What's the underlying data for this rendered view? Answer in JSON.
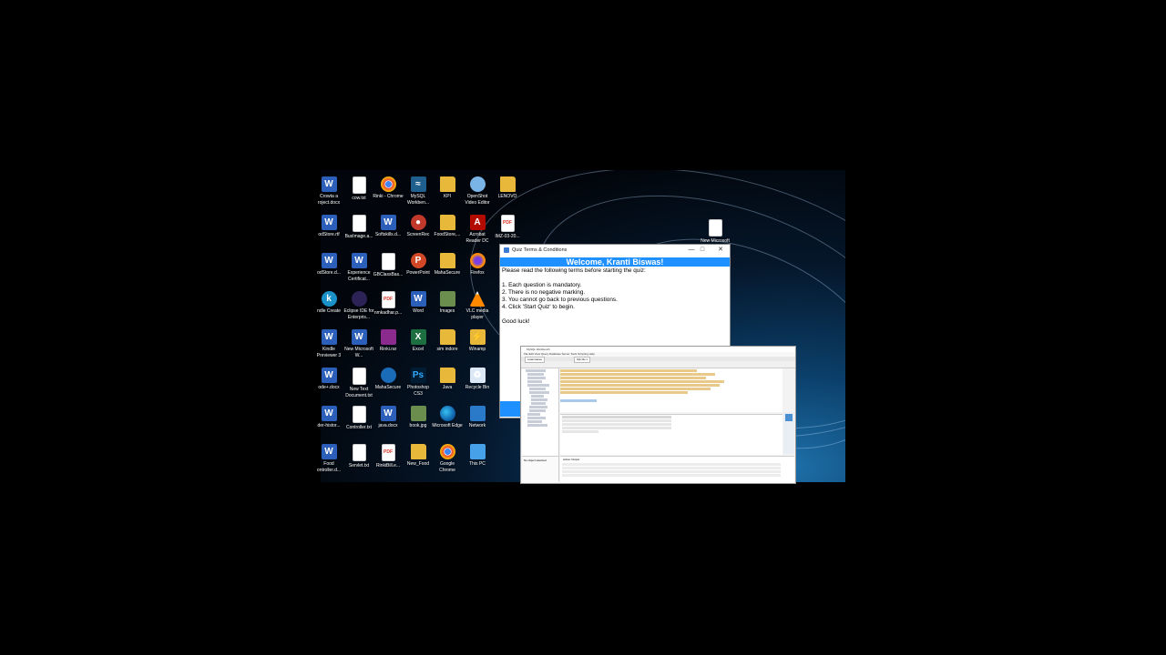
{
  "desktop": {
    "icons": [
      {
        "name": "icon-create-a-project-docx",
        "type": "word",
        "glyph": "W",
        "label": "Crowta a roject.docx",
        "col": 0,
        "row": 0
      },
      {
        "name": "icon-cow-txt",
        "type": "doc",
        "glyph": "",
        "label": "cow.txt",
        "col": 1,
        "row": 0
      },
      {
        "name": "icon-rinki-chrome",
        "type": "chrome",
        "glyph": "",
        "label": "Rinki - Chrome",
        "col": 2,
        "row": 0
      },
      {
        "name": "icon-mysql-workbench",
        "type": "mysql",
        "glyph": "≈",
        "label": "MySQL Workben...",
        "col": 3,
        "row": 0
      },
      {
        "name": "icon-kpi-folder",
        "type": "folder",
        "glyph": "",
        "label": "KPI",
        "col": 4,
        "row": 0
      },
      {
        "name": "icon-openshot-video-editor",
        "type": "openshot",
        "glyph": "",
        "label": "OpenShot Video Editor",
        "col": 5,
        "row": 0
      },
      {
        "name": "icon-lenovo-folder",
        "type": "folder",
        "glyph": "",
        "label": "LENOVO",
        "col": 6,
        "row": 0
      },
      {
        "name": "icon-foodstore-rtf",
        "type": "word",
        "glyph": "W",
        "label": "odStore.rtf",
        "col": 0,
        "row": 1
      },
      {
        "name": "icon-busimage",
        "type": "doc",
        "glyph": "",
        "label": "BusImage.a...",
        "col": 1,
        "row": 1
      },
      {
        "name": "icon-softskills",
        "type": "word",
        "glyph": "W",
        "label": "Softskills.d...",
        "col": 2,
        "row": 1
      },
      {
        "name": "icon-screenrec",
        "type": "screenrec",
        "glyph": "●",
        "label": "ScreenRec",
        "col": 3,
        "row": 1
      },
      {
        "name": "icon-foodstore-folder",
        "type": "folder",
        "glyph": "",
        "label": "FoodStore,...",
        "col": 4,
        "row": 1
      },
      {
        "name": "icon-acrobat-reader",
        "type": "acro",
        "glyph": "A",
        "label": "Acrobat Reader DC",
        "col": 5,
        "row": 1
      },
      {
        "name": "icon-pdf-file",
        "type": "pdf",
        "glyph": "PDF",
        "label": "IMZ-03-20...",
        "col": 6,
        "row": 1
      },
      {
        "name": "icon-foodstore-docx",
        "type": "word",
        "glyph": "W",
        "label": "odStore.d...",
        "col": 0,
        "row": 2
      },
      {
        "name": "icon-experience-certificate",
        "type": "word",
        "glyph": "W",
        "label": "Experience Certificat...",
        "col": 1,
        "row": 2
      },
      {
        "name": "icon-gbclassbas",
        "type": "doc",
        "glyph": "",
        "label": "GBClassBas...",
        "col": 2,
        "row": 2
      },
      {
        "name": "icon-powerpoint",
        "type": "ppt",
        "glyph": "P",
        "label": "PowerPoint",
        "col": 3,
        "row": 2
      },
      {
        "name": "icon-mahasecure-folder",
        "type": "folder",
        "glyph": "",
        "label": "MahaSecure",
        "col": 4,
        "row": 2
      },
      {
        "name": "icon-firefox",
        "type": "firefox",
        "glyph": "",
        "label": "Firefox",
        "col": 5,
        "row": 2
      },
      {
        "name": "icon-kindle-create",
        "type": "kindle",
        "glyph": "k",
        "label": "ndle Create",
        "col": 0,
        "row": 3
      },
      {
        "name": "icon-eclipse-ide",
        "type": "eclipse",
        "glyph": "",
        "label": "Eclipse IDE for Enterpris...",
        "col": 1,
        "row": 3
      },
      {
        "name": "icon-nmkadhar-pdf",
        "type": "pdf",
        "glyph": "PDF",
        "label": "nmkadhar.p...",
        "col": 2,
        "row": 3
      },
      {
        "name": "icon-word",
        "type": "word",
        "glyph": "W",
        "label": "Word",
        "col": 3,
        "row": 3
      },
      {
        "name": "icon-images-folder",
        "type": "img",
        "glyph": "",
        "label": "Images",
        "col": 4,
        "row": 3
      },
      {
        "name": "icon-vlc-media-player",
        "type": "vlc",
        "glyph": "",
        "label": "VLC media player",
        "col": 5,
        "row": 3
      },
      {
        "name": "icon-kindle-previewer",
        "type": "word",
        "glyph": "W",
        "label": "Kindle Previewer 3",
        "col": 0,
        "row": 4
      },
      {
        "name": "icon-new-microsoft-word",
        "type": "word",
        "glyph": "W",
        "label": "New Microsoft W...",
        "col": 1,
        "row": 4
      },
      {
        "name": "icon-rinki-rar",
        "type": "rar",
        "glyph": "",
        "label": "Rinki.rar",
        "col": 2,
        "row": 4
      },
      {
        "name": "icon-excel",
        "type": "excel",
        "glyph": "X",
        "label": "Excel",
        "col": 3,
        "row": 4
      },
      {
        "name": "icon-sim-indore-folder",
        "type": "folder",
        "glyph": "",
        "label": "sim indore",
        "col": 4,
        "row": 4
      },
      {
        "name": "icon-winamp",
        "type": "winamp",
        "glyph": "⚡",
        "label": "Winamp",
        "col": 5,
        "row": 4
      },
      {
        "name": "icon-code-docx",
        "type": "word",
        "glyph": "W",
        "label": "ode+.docx",
        "col": 0,
        "row": 5
      },
      {
        "name": "icon-new-text-document",
        "type": "doc",
        "glyph": "",
        "label": "New Text Document.txt",
        "col": 1,
        "row": 5
      },
      {
        "name": "icon-mahasecure",
        "type": "shield",
        "glyph": "",
        "label": "MahaSecure",
        "col": 2,
        "row": 5
      },
      {
        "name": "icon-photoshop-cs3",
        "type": "ps",
        "glyph": "Ps",
        "label": "Photoshop CS3",
        "col": 3,
        "row": 5
      },
      {
        "name": "icon-java-folder",
        "type": "folder",
        "glyph": "",
        "label": "Java",
        "col": 4,
        "row": 5
      },
      {
        "name": "icon-recycle-bin",
        "type": "recycle",
        "glyph": "♻",
        "label": "Recycle Bin",
        "col": 5,
        "row": 5
      },
      {
        "name": "icon-order-history",
        "type": "word",
        "glyph": "W",
        "label": "der-histor...",
        "col": 0,
        "row": 6
      },
      {
        "name": "icon-controller-txt",
        "type": "doc",
        "glyph": "",
        "label": "Controller.txt",
        "col": 1,
        "row": 6
      },
      {
        "name": "icon-java-docx",
        "type": "word",
        "glyph": "W",
        "label": "java.docx",
        "col": 2,
        "row": 6
      },
      {
        "name": "icon-book-jpg",
        "type": "img",
        "glyph": "",
        "label": "book.jpg",
        "col": 3,
        "row": 6
      },
      {
        "name": "icon-microsoft-edge",
        "type": "edge",
        "glyph": "",
        "label": "Microsoft Edge",
        "col": 4,
        "row": 6
      },
      {
        "name": "icon-network",
        "type": "network",
        "glyph": "",
        "label": "Network",
        "col": 5,
        "row": 6
      },
      {
        "name": "icon-food-controller",
        "type": "word",
        "glyph": "W",
        "label": "Food ontroller.d...",
        "col": 0,
        "row": 7
      },
      {
        "name": "icon-servlet-txt",
        "type": "doc",
        "glyph": "",
        "label": "Servlet.txt",
        "col": 1,
        "row": 7
      },
      {
        "name": "icon-rinkibill-pdf",
        "type": "pdf",
        "glyph": "PDF",
        "label": "RinkiBill.e...",
        "col": 2,
        "row": 7
      },
      {
        "name": "icon-new-food-folder",
        "type": "folder",
        "glyph": "",
        "label": "New_Food",
        "col": 3,
        "row": 7
      },
      {
        "name": "icon-google-chrome",
        "type": "chrome",
        "glyph": "",
        "label": "Google Chrome",
        "col": 4,
        "row": 7
      },
      {
        "name": "icon-this-pc",
        "type": "thispc",
        "glyph": "",
        "label": "This PC",
        "col": 5,
        "row": 7
      }
    ],
    "right_icon": {
      "name": "icon-new-microsoft-powerpoint",
      "type": "pdf",
      "glyph": "",
      "label": "New Microsoft P..."
    }
  },
  "quiz_window": {
    "title": "Quiz Terms & Conditions",
    "minimize": "—",
    "maximize": "□",
    "close": "✕",
    "welcome": "Welcome, Kranti Biswas!",
    "intro": "Please read the following terms before starting the quiz:",
    "terms": [
      "1. Each question is mandatory.",
      "2. There is no negative marking.",
      "3. You cannot go back to previous questions.",
      "4. Click 'Start Quiz' to begin."
    ],
    "closing": "Good luck!"
  },
  "workbench_window": {
    "title": "MySQL Workbench",
    "menu": "File  Edit  View  Query  Database  Server  Tools  Scripting  Help",
    "tabs": [
      "Local instance",
      "SQL File 1"
    ],
    "status": "No object selected",
    "output_label": "Action Output"
  }
}
